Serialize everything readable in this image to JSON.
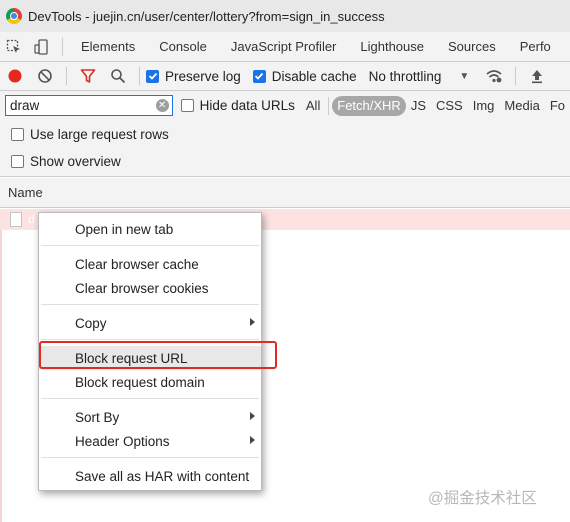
{
  "window": {
    "title": "DevTools - juejin.cn/user/center/lottery?from=sign_in_success",
    "icon": "chrome-icon"
  },
  "tabs": [
    "Elements",
    "Console",
    "JavaScript Profiler",
    "Lighthouse",
    "Sources",
    "Perfo"
  ],
  "toolbar": {
    "preserve_log": {
      "label": "Preserve log",
      "checked": true
    },
    "disable_cache": {
      "label": "Disable cache",
      "checked": true
    },
    "throttling": "No throttling"
  },
  "filter": {
    "value": "draw",
    "hide_data_urls": "Hide data URLs",
    "types": [
      "All",
      "Fetch/XHR",
      "JS",
      "CSS",
      "Img",
      "Media",
      "Fo"
    ],
    "active_type": "Fetch/XHR"
  },
  "options": {
    "large_rows": "Use large request rows",
    "overview": "Show overview"
  },
  "table": {
    "name_header": "Name",
    "request_name": "d"
  },
  "context_menu": {
    "open_new_tab": "Open in new tab",
    "clear_cache": "Clear browser cache",
    "clear_cookies": "Clear browser cookies",
    "copy": "Copy",
    "block_url": "Block request URL",
    "block_domain": "Block request domain",
    "sort_by": "Sort By",
    "header_options": "Header Options",
    "save_har": "Save all as HAR with content"
  },
  "watermark": "@掘金技术社区",
  "colors": {
    "accent": "#1a73e8",
    "record": "#e8281c",
    "filter_icon": "#d93025",
    "highlight": "#e02b2b",
    "row_error": "#fde2e2"
  }
}
